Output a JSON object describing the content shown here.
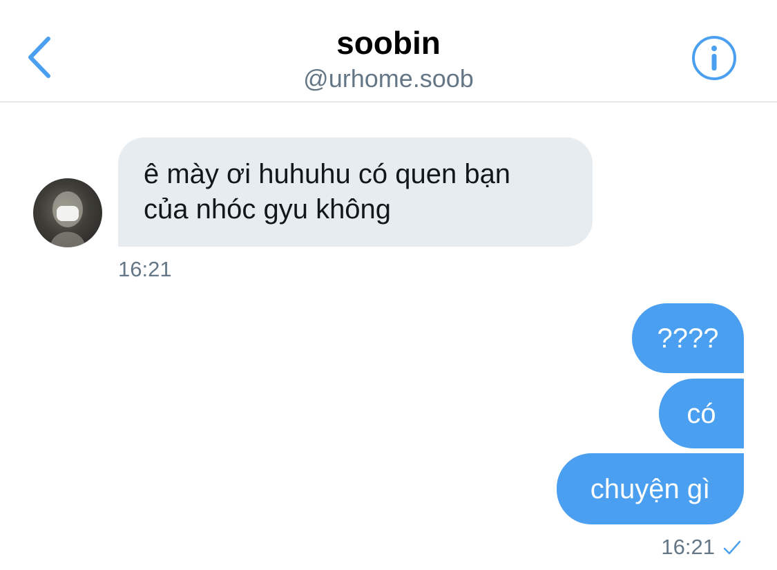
{
  "header": {
    "back_icon": "chevron-left-icon",
    "name": "soobin",
    "handle": "@urhome.soob",
    "info_icon": "info-circle-icon"
  },
  "colors": {
    "accent": "#4a9ff0",
    "incoming_bubble": "#e6ecf0",
    "secondary_text": "#657786"
  },
  "messages": {
    "incoming": [
      {
        "lines": [
          "ê mày ơi huhuhu có quen bạn",
          "của nhóc gyu không"
        ],
        "time": "16:21"
      }
    ],
    "outgoing": [
      {
        "text": "????"
      },
      {
        "text": "có"
      },
      {
        "text": "chuyện gì"
      }
    ],
    "outgoing_time": "16:21",
    "outgoing_status_icon": "checkmark-icon"
  }
}
